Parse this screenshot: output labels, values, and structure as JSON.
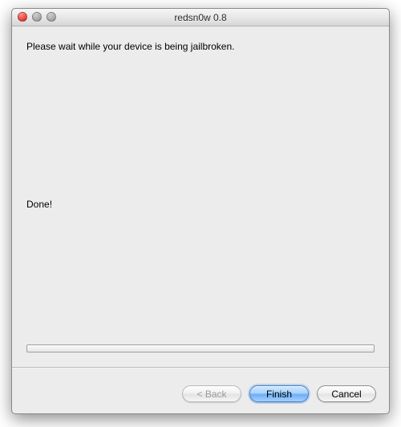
{
  "window": {
    "title": "redsn0w 0.8"
  },
  "content": {
    "instruction": "Please wait while your device is being jailbroken.",
    "status": "Done!"
  },
  "footer": {
    "back_label": "< Back",
    "finish_label": "Finish",
    "cancel_label": "Cancel"
  }
}
